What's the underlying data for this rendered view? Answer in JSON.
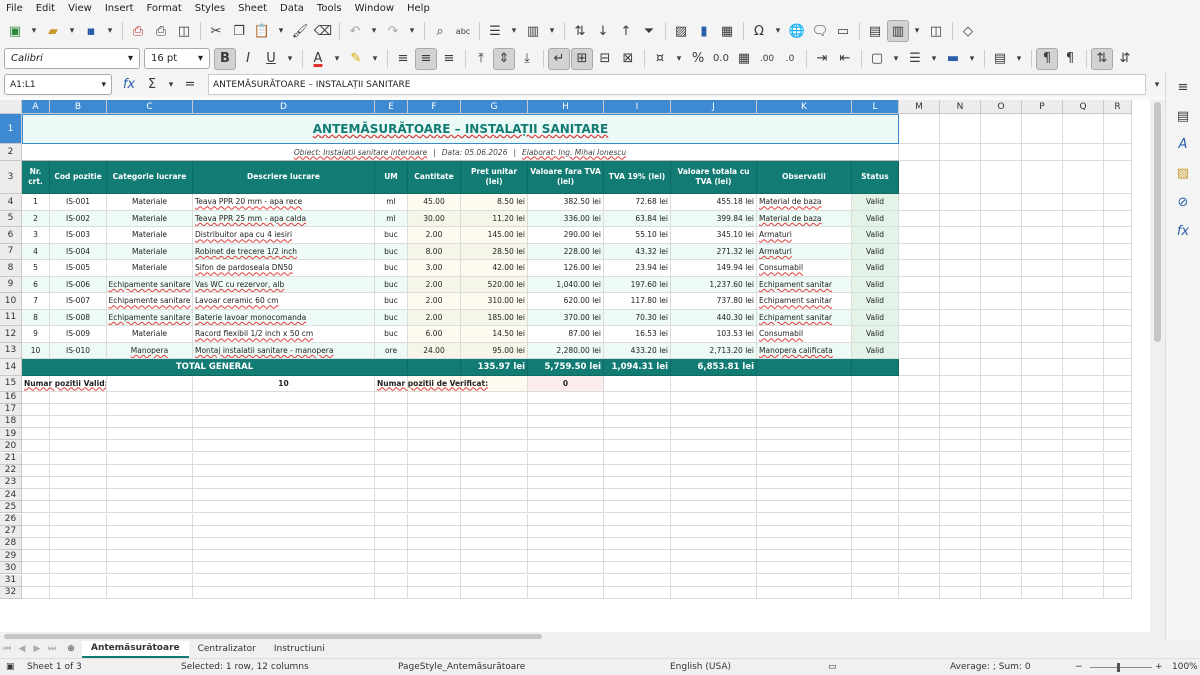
{
  "menu": [
    "File",
    "Edit",
    "View",
    "Insert",
    "Format",
    "Styles",
    "Sheet",
    "Data",
    "Tools",
    "Window",
    "Help"
  ],
  "font": {
    "name": "Calibri",
    "size": "16 pt"
  },
  "namebox": "A1:L1",
  "formula": "ANTEMĂSURĂTOARE – INSTALAȚII SANITARE",
  "columns": [
    "A",
    "B",
    "C",
    "D",
    "E",
    "F",
    "G",
    "H",
    "I",
    "J",
    "K",
    "L",
    "M",
    "N",
    "O",
    "P",
    "Q",
    "R"
  ],
  "sheet": {
    "title": "ANTEMĂSURĂTOARE – INSTALAȚII SANITARE",
    "subtitle": {
      "obiect": "Obiect: Instalatii sanitare interioare",
      "sep1": "|",
      "data": "Data: 05.06.2026",
      "sep2": "|",
      "elaborat": "Elaborat: Ing. Mihai Ionescu"
    },
    "headers": [
      "Nr. crt.",
      "Cod pozitie",
      "Categorie lucrare",
      "Descriere lucrare",
      "UM",
      "Cantitate",
      "Pret unitar (lei)",
      "Valoare fara TVA (lei)",
      "TVA 19% (lei)",
      "Valoare totala cu TVA (lei)",
      "Observatii",
      "Status"
    ],
    "rows": [
      [
        "1",
        "IS-001",
        "Materiale",
        "Teava PPR 20 mm - apa rece",
        "ml",
        "45.00",
        "8.50 lei",
        "382.50 lei",
        "72.68 lei",
        "455.18 lei",
        "Material de baza",
        "Valid"
      ],
      [
        "2",
        "IS-002",
        "Materiale",
        "Teava PPR 25 mm - apa calda",
        "ml",
        "30.00",
        "11.20 lei",
        "336.00 lei",
        "63.84 lei",
        "399.84 lei",
        "Material de baza",
        "Valid"
      ],
      [
        "3",
        "IS-003",
        "Materiale",
        "Distribuitor apa cu 4 iesiri",
        "buc",
        "2.00",
        "145.00 lei",
        "290.00 lei",
        "55.10 lei",
        "345.10 lei",
        "Armaturi",
        "Valid"
      ],
      [
        "4",
        "IS-004",
        "Materiale",
        "Robinet de trecere 1/2 inch",
        "buc",
        "8.00",
        "28.50 lei",
        "228.00 lei",
        "43.32 lei",
        "271.32 lei",
        "Armaturi",
        "Valid"
      ],
      [
        "5",
        "IS-005",
        "Materiale",
        "Sifon de pardoseala DN50",
        "buc",
        "3.00",
        "42.00 lei",
        "126.00 lei",
        "23.94 lei",
        "149.94 lei",
        "Consumabil",
        "Valid"
      ],
      [
        "6",
        "IS-006",
        "Echipamente sanitare",
        "Vas WC cu rezervor, alb",
        "buc",
        "2.00",
        "520.00 lei",
        "1,040.00 lei",
        "197.60 lei",
        "1,237.60 lei",
        "Echipament sanitar",
        "Valid"
      ],
      [
        "7",
        "IS-007",
        "Echipamente sanitare",
        "Lavoar ceramic 60 cm",
        "buc",
        "2.00",
        "310.00 lei",
        "620.00 lei",
        "117.80 lei",
        "737.80 lei",
        "Echipament sanitar",
        "Valid"
      ],
      [
        "8",
        "IS-008",
        "Echipamente sanitare",
        "Baterie lavoar monocomanda",
        "buc",
        "2.00",
        "185.00 lei",
        "370.00 lei",
        "70.30 lei",
        "440.30 lei",
        "Echipament sanitar",
        "Valid"
      ],
      [
        "9",
        "IS-009",
        "Materiale",
        "Racord flexibil 1/2 inch x 50 cm",
        "buc",
        "6.00",
        "14.50 lei",
        "87.00 lei",
        "16.53 lei",
        "103.53 lei",
        "Consumabil",
        "Valid"
      ],
      [
        "10",
        "IS-010",
        "Manopera",
        "Montaj instalatii sanitare - manopera",
        "ore",
        "24.00",
        "95.00 lei",
        "2,280.00 lei",
        "433.20 lei",
        "2,713.20 lei",
        "Manopera calificata",
        "Valid"
      ]
    ],
    "total": {
      "label": "TOTAL GENERAL",
      "pret": "135.97 lei",
      "fara_tva": "5,759.50 lei",
      "tva": "1,094.31 lei",
      "totala": "6,853.81 lei"
    },
    "summary": {
      "valid_label": "Numar pozitii Valid:",
      "valid_count": "10",
      "verif_label": "Numar pozitii de Verificat:",
      "verif_count": "0"
    }
  },
  "tabs": [
    "Antemăsurătoare",
    "Centralizator",
    "Instructiuni"
  ],
  "status": {
    "sheet": "Sheet 1 of 3",
    "selection": "Selected: 1 row, 12 columns",
    "pagestyle": "PageStyle_Antemăsurătoare",
    "lang": "English (USA)",
    "sum": "Average: ; Sum: 0",
    "zoom": "100%"
  },
  "colors": {
    "header": "#127c74",
    "title_bg": "#ebfaf6",
    "selection": "#3d8ad2"
  }
}
